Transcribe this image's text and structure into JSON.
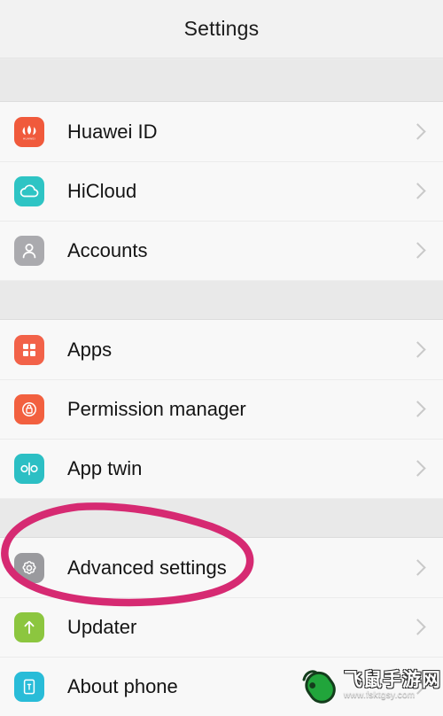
{
  "header": {
    "title": "Settings"
  },
  "colors": {
    "huawei_red": "#f05a3c",
    "hicloud_teal": "#2ec4c4",
    "accounts_gray": "#aaaaae",
    "apps_red": "#f26249",
    "permission_red": "#f2603f",
    "apptwin_teal": "#2cbfc4",
    "advanced_gray": "#9a9a9e",
    "updater_green": "#8cc63f",
    "about_cyan": "#29bcd8",
    "annotation_pink": "#d62a72",
    "chevron_gray": "#c9c9c9"
  },
  "sections": [
    {
      "name": "accounts-section",
      "items": [
        {
          "label": "Huawei ID",
          "icon": "huawei-logo-icon",
          "chevron": "chevron-right-icon"
        },
        {
          "label": "HiCloud",
          "icon": "cloud-icon",
          "chevron": "chevron-right-icon"
        },
        {
          "label": "Accounts",
          "icon": "person-icon",
          "chevron": "chevron-right-icon"
        }
      ]
    },
    {
      "name": "apps-section",
      "items": [
        {
          "label": "Apps",
          "icon": "grid-apps-icon",
          "chevron": "chevron-right-icon"
        },
        {
          "label": "Permission manager",
          "icon": "lock-shield-icon",
          "chevron": "chevron-right-icon"
        },
        {
          "label": "App twin",
          "icon": "app-twin-icon",
          "chevron": "chevron-right-icon"
        }
      ]
    },
    {
      "name": "system-section",
      "items": [
        {
          "label": "Advanced settings",
          "icon": "gear-icon",
          "chevron": "chevron-right-icon"
        },
        {
          "label": "Updater",
          "icon": "up-arrow-icon",
          "chevron": "chevron-right-icon"
        },
        {
          "label": "About phone",
          "icon": "phone-info-icon",
          "chevron": "chevron-right-icon"
        }
      ]
    }
  ],
  "annotation": {
    "name": "highlight-circle",
    "target": "Advanced settings",
    "shape": "hand-drawn-oval"
  },
  "watermark": {
    "site_name": "飞鼠手游网",
    "url": "www.fsktgsy.com",
    "logo": "green-mouse-icon"
  }
}
